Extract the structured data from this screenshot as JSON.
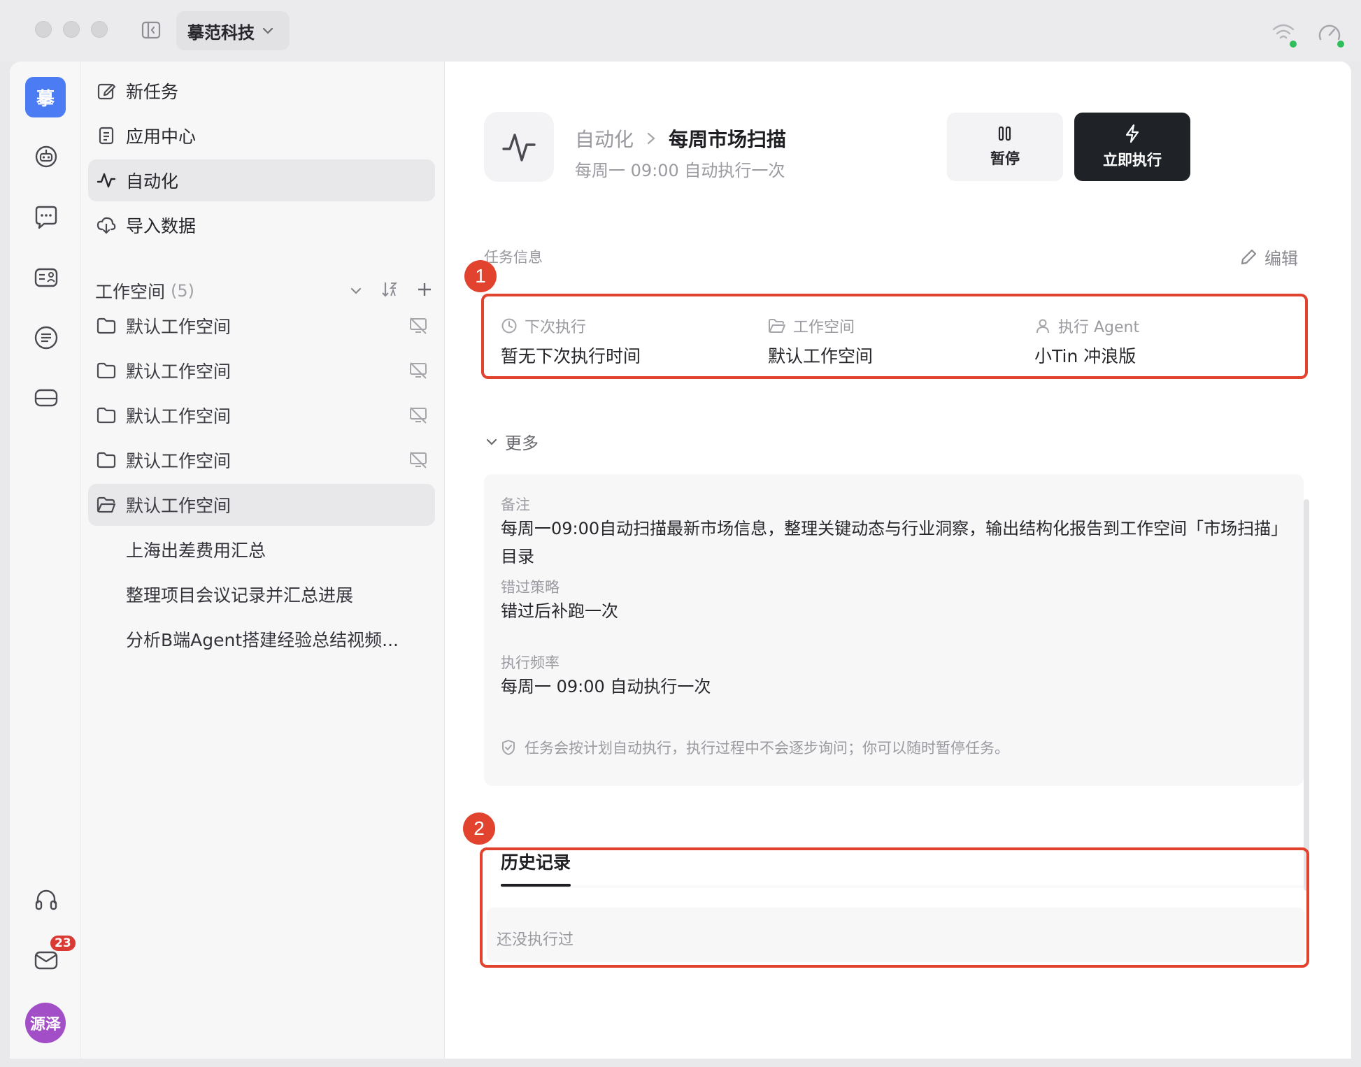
{
  "titlebar": {
    "org_name": "摹范科技"
  },
  "rail": {
    "logo_text": "摹",
    "mail_badge": "23",
    "avatar_text": "源泽"
  },
  "nav": {
    "items": [
      {
        "label": "新任务",
        "icon": "edit-icon"
      },
      {
        "label": "应用中心",
        "icon": "app-doc-icon"
      },
      {
        "label": "自动化",
        "icon": "pulse-icon"
      },
      {
        "label": "导入数据",
        "icon": "cloud-download-icon"
      }
    ],
    "workspace": {
      "title": "工作空间",
      "count": "(5)",
      "items": [
        {
          "label": "默认工作空间"
        },
        {
          "label": "默认工作空间"
        },
        {
          "label": "默认工作空间"
        },
        {
          "label": "默认工作空间"
        },
        {
          "label": "默认工作空间"
        }
      ],
      "sub_items": [
        {
          "label": "上海出差费用汇总"
        },
        {
          "label": "整理项目会议记录并汇总进展"
        },
        {
          "label": "分析B端Agent搭建经验总结视频..."
        }
      ]
    }
  },
  "main": {
    "breadcrumb_parent": "自动化",
    "title": "每周市场扫描",
    "subtitle": "每周一 09:00 自动执行一次",
    "pause_label": "暂停",
    "run_label": "立即执行",
    "section_label": "任务信息",
    "edit_label": "编辑",
    "annotations": [
      "1",
      "2"
    ],
    "info": {
      "next_run_label": "下次执行",
      "next_run_value": "暂无下次执行时间",
      "workspace_label": "工作空间",
      "workspace_value": "默认工作空间",
      "agent_label": "执行 Agent",
      "agent_value": "小Tin 冲浪版"
    },
    "more": {
      "toggle_label": "更多",
      "note_label": "备注",
      "note_value": "每周一09:00自动扫描最新市场信息，整理关键动态与行业洞察，输出结构化报告到工作空间「市场扫描」目录",
      "miss_label": "错过策略",
      "miss_value": "错过后补跑一次",
      "freq_label": "执行频率",
      "freq_value": "每周一 09:00 自动执行一次",
      "notice": "任务会按计划自动执行，执行过程中不会逐步询问；你可以随时暂停任务。"
    },
    "history": {
      "tab_label": "历史记录",
      "empty_text": "还没执行过"
    }
  },
  "colors": {
    "accent_blue": "#4b7cf3",
    "annotation_red": "#e2432e",
    "primary_dark": "#1f2327",
    "avatar_purple": "#a24fc7",
    "badge_red": "#d93a33",
    "status_green": "#2fbf5a"
  }
}
